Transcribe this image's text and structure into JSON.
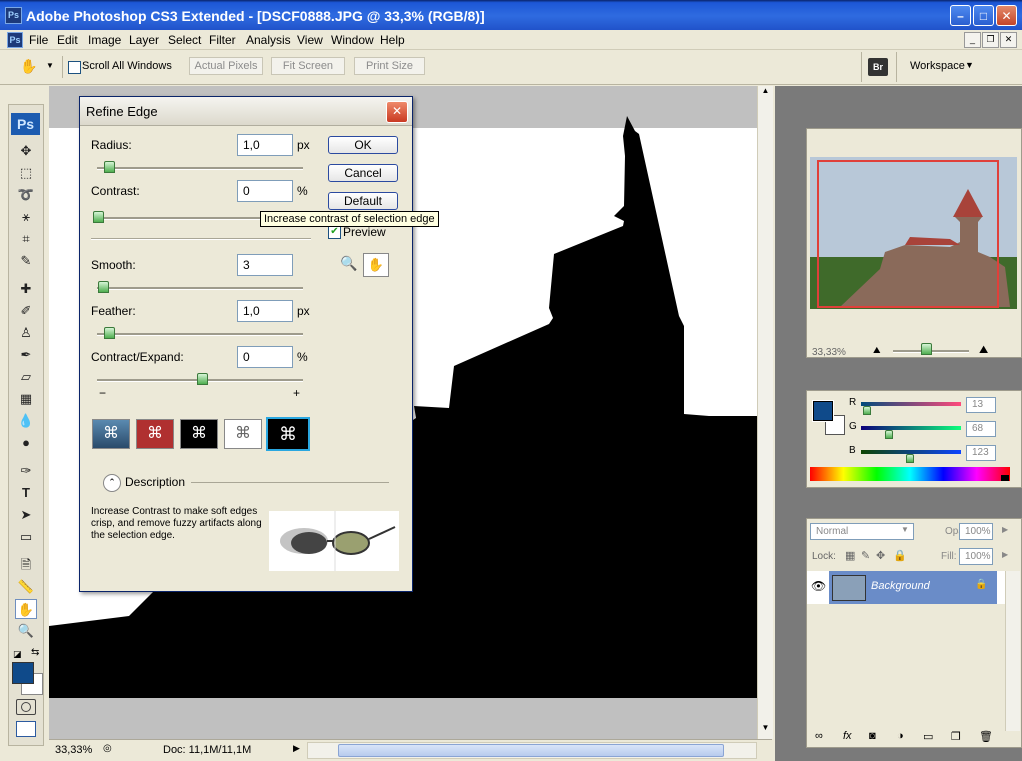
{
  "window": {
    "title": "Adobe Photoshop CS3 Extended - [DSCF0888.JPG @ 33,3% (RGB/8)]",
    "app_icon": "Ps"
  },
  "menu": [
    "File",
    "Edit",
    "Image",
    "Layer",
    "Select",
    "Filter",
    "Analysis",
    "View",
    "Window",
    "Help"
  ],
  "options_bar": {
    "scroll_all_windows": "Scroll All Windows",
    "actual_pixels": "Actual Pixels",
    "fit_screen": "Fit Screen",
    "print_size": "Print Size",
    "workspace": "Workspace"
  },
  "toolbox": {
    "logo": "Ps",
    "foreground_color": "#0f4a8a",
    "background_color": "#ffffff"
  },
  "status": {
    "zoom": "33,33%",
    "doc": "Doc: 11,1M/11,1M"
  },
  "navigator": {
    "zoom": "33,33%"
  },
  "color_panel": {
    "r_label": "R",
    "g_label": "G",
    "b_label": "B",
    "r_value": "13",
    "g_value": "68",
    "b_value": "123",
    "r_fraction": 0.05,
    "g_fraction": 0.27,
    "b_fraction": 0.48
  },
  "layers_panel": {
    "blend_mode": "Normal",
    "opacity_label": "Opacity:",
    "opacity_value": "100%",
    "lock_label": "Lock:",
    "fill_label": "Fill:",
    "fill_value": "100%",
    "layer_name": "Background"
  },
  "refine_edge": {
    "title": "Refine Edge",
    "radius_label": "Radius:",
    "radius_value": "1,0",
    "radius_unit": "px",
    "contrast_label": "Contrast:",
    "contrast_value": "0",
    "contrast_unit": "%",
    "smooth_label": "Smooth:",
    "smooth_value": "3",
    "feather_label": "Feather:",
    "feather_value": "1,0",
    "feather_unit": "px",
    "contract_label": "Contract/Expand:",
    "contract_value": "0",
    "contract_unit": "%",
    "minus": "−",
    "plus": "+",
    "ok": "OK",
    "cancel": "Cancel",
    "default": "Default",
    "preview": "Preview",
    "tooltip": "Increase contrast of selection edge",
    "description_header": "Description",
    "description_text": "Increase Contrast to make soft edges crisp, and remove fuzzy artifacts along the selection edge."
  }
}
